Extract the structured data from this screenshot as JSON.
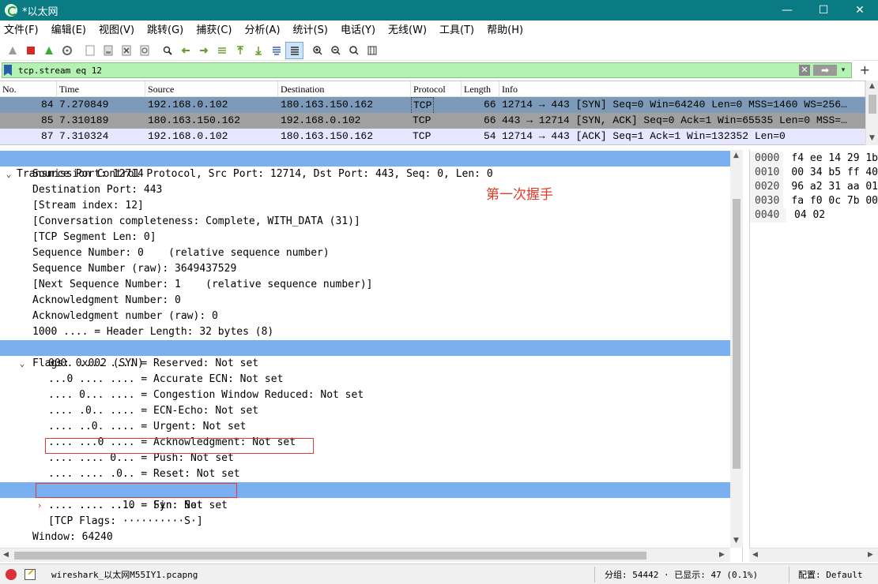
{
  "window": {
    "title": "*以太网",
    "controls": [
      "—",
      "☐",
      "✕"
    ]
  },
  "menu": [
    "文件(F)",
    "编辑(E)",
    "视图(V)",
    "跳转(G)",
    "捕获(C)",
    "分析(A)",
    "统计(S)",
    "电话(Y)",
    "无线(W)",
    "工具(T)",
    "帮助(H)"
  ],
  "filter": {
    "value": "tcp.stream eq 12",
    "clear_icon": "✕",
    "apply_icon": "➡",
    "dropdown_icon": "▾",
    "add_icon": "+"
  },
  "packet_list": {
    "columns": [
      "No.",
      "Time",
      "Source",
      "Destination",
      "Protocol",
      "Length",
      "Info"
    ],
    "rows": [
      {
        "no": "84",
        "time": "7.270849",
        "src": "192.168.0.102",
        "dst": "180.163.150.162",
        "proto": "TCP",
        "len": "66",
        "info": "12714 → 443 [SYN] Seq=0 Win=64240 Len=0 MSS=1460 WS=256…"
      },
      {
        "no": "85",
        "time": "7.310189",
        "src": "180.163.150.162",
        "dst": "192.168.0.102",
        "proto": "TCP",
        "len": "66",
        "info": "443 → 12714 [SYN, ACK] Seq=0 Ack=1 Win=65535 Len=0 MSS=…"
      },
      {
        "no": "87",
        "time": "7.310324",
        "src": "192.168.0.102",
        "dst": "180.163.150.162",
        "proto": "TCP",
        "len": "54",
        "info": "12714 → 443 [ACK] Seq=1 Ack=1 Win=132352 Len=0"
      }
    ]
  },
  "details": {
    "header": "Transmission Control Protocol, Src Port: 12714, Dst Port: 443, Seq: 0, Len: 0",
    "lines": [
      "Source Port: 12714",
      "Destination Port: 443",
      "[Stream index: 12]",
      "[Conversation completeness: Complete, WITH_DATA (31)]",
      "[TCP Segment Len: 0]",
      "Sequence Number: 0    (relative sequence number)",
      "Sequence Number (raw): 3649437529",
      "[Next Sequence Number: 1    (relative sequence number)]",
      "Acknowledgment Number: 0",
      "Acknowledgment number (raw): 0",
      "1000 .... = Header Length: 32 bytes (8)"
    ],
    "flags_header": "Flags: 0x002 (SYN)",
    "flag_lines": [
      "000. .... .... = Reserved: Not set",
      "...0 .... .... = Accurate ECN: Not set",
      ".... 0... .... = Congestion Window Reduced: Not set",
      ".... .0.. .... = ECN-Echo: Not set",
      ".... ..0. .... = Urgent: Not set",
      ".... ...0 .... = Acknowledgment: Not set",
      ".... .... 0... = Push: Not set",
      ".... .... .0.. = Reset: Not set",
      ".... .... ..1. = Syn: Set",
      ".... .... ...0 = Fin: Not set",
      "[TCP Flags: ··········S·]"
    ],
    "window_line": "Window: 64240",
    "annotation": "第一次握手"
  },
  "bytes": [
    {
      "offset": "0000",
      "hex": "f4 ee 14 29 1b"
    },
    {
      "offset": "0010",
      "hex": "00 34 b5 ff 40"
    },
    {
      "offset": "0020",
      "hex": "96 a2 31 aa 01"
    },
    {
      "offset": "0030",
      "hex": "fa f0 0c 7b 00"
    },
    {
      "offset": "0040",
      "hex": "04 02"
    }
  ],
  "status": {
    "file": "wireshark_以太网M55IY1.pcapng",
    "stats": "分组: 54442 · 已显示: 47 (0.1%)",
    "profile": "配置: Default"
  },
  "colors": {
    "titlebar": "#0a7b83",
    "filter_bg": "#b3f2b3",
    "selected_row": "#7d9bb8",
    "highlight": "#7ab0f0",
    "annotation": "#e03a2a"
  }
}
